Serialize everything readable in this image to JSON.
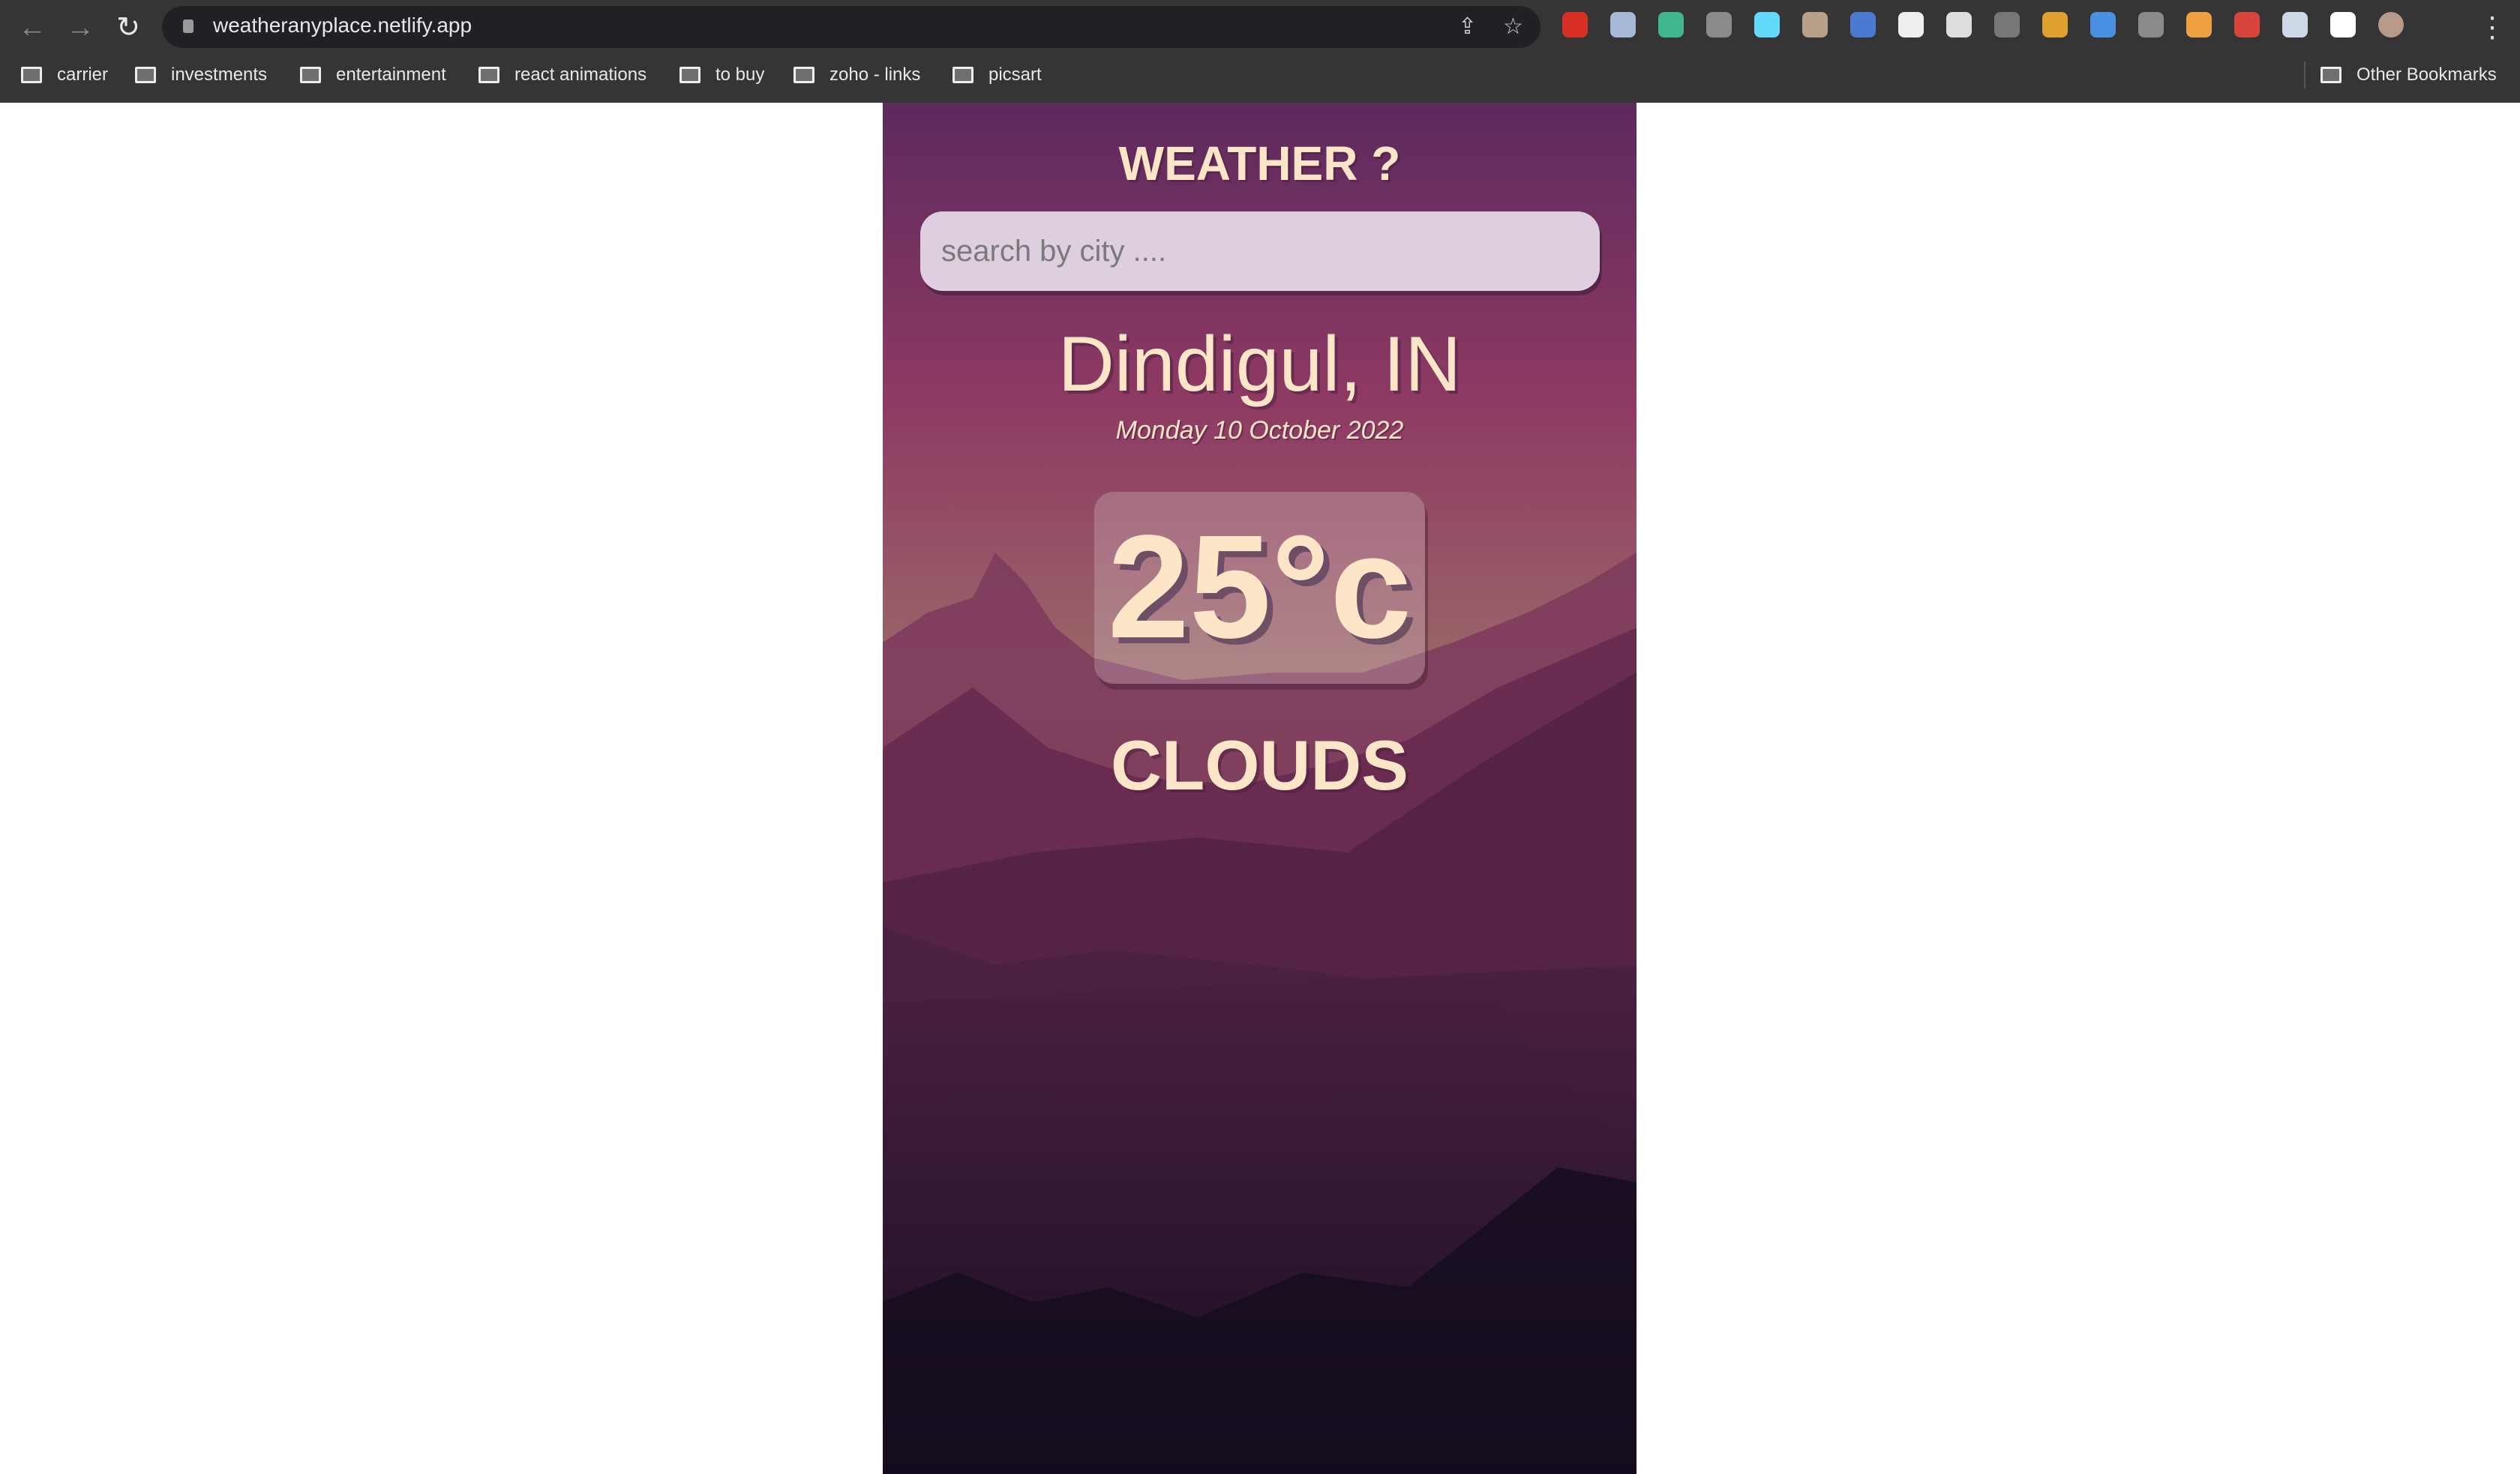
{
  "browser": {
    "url": "weatheranyplace.netlify.app",
    "bookmarks": [
      "carrier",
      "investments",
      "entertainment",
      "react animations",
      "to buy",
      "zoho - links",
      "picsart"
    ],
    "other_bookmarks": "Other Bookmarks",
    "extension_colors": [
      "#d93025",
      "#a8b8d8",
      "#3fb68b",
      "#8a8a8a",
      "#61dafb",
      "#b8a08a",
      "#4a7bd0",
      "#eeeeee",
      "#dddddd",
      "#777777",
      "#e0a030",
      "#4a90e2",
      "#8a8a8a",
      "#f0a040",
      "#d9453b",
      "#cfd8e8",
      "#ffffff",
      "#ffffff"
    ]
  },
  "app": {
    "title": "WEATHER ?",
    "search_placeholder": "search by city ....",
    "search_value": "",
    "location": "Dindigul, IN",
    "date": "Monday 10 October 2022",
    "temperature": "25°c",
    "condition": "CLOUDS"
  },
  "colors": {
    "text": "#fde6c8",
    "sky_top": "#5c2a5e",
    "sky_mid": "#8f3a63",
    "horizon": "#9a6868",
    "ground_dark": "#120c1c"
  }
}
